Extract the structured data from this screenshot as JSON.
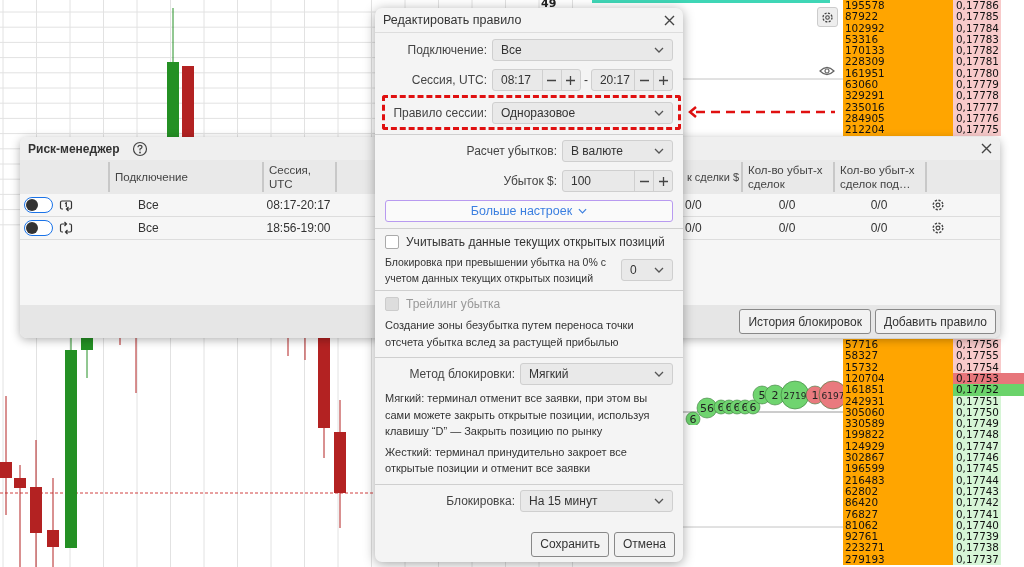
{
  "chart": {
    "axis_label": "49",
    "bubbles": [
      {
        "label": "6",
        "color": "#6fd46f"
      },
      {
        "label": "56",
        "color": "#6fd46f"
      },
      {
        "label": "6",
        "color": "#6fd46f"
      },
      {
        "label": "6",
        "color": "#6fd46f"
      },
      {
        "label": "6",
        "color": "#6fd46f"
      },
      {
        "label": "6",
        "color": "#6fd46f"
      },
      {
        "label": "6",
        "color": "#6fd46f"
      },
      {
        "label": "5",
        "color": "#6fd46f"
      },
      {
        "label": "2",
        "color": "#6fd46f"
      },
      {
        "label": "2719",
        "color": "#6fd46f"
      },
      {
        "label": "1",
        "color": "#e97a7e"
      },
      {
        "label": "6197",
        "color": "#e97a7e"
      }
    ]
  },
  "orderbook": {
    "top_rows": [
      {
        "volume": "195578",
        "price": "0,17786",
        "kind": "ask"
      },
      {
        "volume": "87922",
        "price": "0,17785",
        "kind": "ask"
      },
      {
        "volume": "102992",
        "price": "0,17784",
        "kind": "ask"
      },
      {
        "volume": "53316",
        "price": "0,17783",
        "kind": "ask"
      },
      {
        "volume": "170133",
        "price": "0,17782",
        "kind": "ask"
      },
      {
        "volume": "228309",
        "price": "0,17781",
        "kind": "ask"
      },
      {
        "volume": "161951",
        "price": "0,17780",
        "kind": "ask"
      },
      {
        "volume": "63060",
        "price": "0,17779",
        "kind": "ask"
      },
      {
        "volume": "329291",
        "price": "0,17778",
        "kind": "ask"
      },
      {
        "volume": "235016",
        "price": "0,17777",
        "kind": "ask"
      },
      {
        "volume": "284905",
        "price": "0,17776",
        "kind": "ask"
      },
      {
        "volume": "212204",
        "price": "0,17775",
        "kind": "ask"
      }
    ],
    "bottom_rows": [
      {
        "volume": "57716",
        "price": "0,17756",
        "kind": "ask"
      },
      {
        "volume": "58327",
        "price": "0,17755",
        "kind": "ask"
      },
      {
        "volume": "15732",
        "price": "0,17754",
        "kind": "ask"
      },
      {
        "volume": "120704",
        "price": "0,17753",
        "kind": "best_ask"
      },
      {
        "volume": "161851",
        "price": "0,17752",
        "kind": "best_bid"
      },
      {
        "volume": "242931",
        "price": "0,17751",
        "kind": "bid"
      },
      {
        "volume": "305060",
        "price": "0,17750",
        "kind": "bid"
      },
      {
        "volume": "330589",
        "price": "0,17749",
        "kind": "bid"
      },
      {
        "volume": "199822",
        "price": "0,17748",
        "kind": "bid"
      },
      {
        "volume": "124929",
        "price": "0,17747",
        "kind": "bid"
      },
      {
        "volume": "302867",
        "price": "0,17746",
        "kind": "bid"
      },
      {
        "volume": "196599",
        "price": "0,17745",
        "kind": "bid"
      },
      {
        "volume": "216483",
        "price": "0,17744",
        "kind": "bid"
      },
      {
        "volume": "62802",
        "price": "0,17743",
        "kind": "bid"
      },
      {
        "volume": "86420",
        "price": "0,17742",
        "kind": "bid"
      },
      {
        "volume": "76827",
        "price": "0,17741",
        "kind": "bid"
      },
      {
        "volume": "81062",
        "price": "0,17740",
        "kind": "bid"
      },
      {
        "volume": "92761",
        "price": "0,17739",
        "kind": "bid"
      },
      {
        "volume": "223271",
        "price": "0,17738",
        "kind": "bid"
      },
      {
        "volume": "279193",
        "price": "0,17737",
        "kind": "bid"
      }
    ]
  },
  "risk_manager": {
    "title": "Риск-менеджер",
    "columns": [
      "Подключение",
      "Сессия, UTC",
      "к сделки $",
      "Кол-во убыт-х сделок",
      "Кол-во убыт-х сделок под…"
    ],
    "rules": [
      {
        "on": false,
        "kind": "once",
        "connection": "Все",
        "session": "08:17-20:17",
        "cells": [
          "0/0",
          "0/0",
          "0/0"
        ]
      },
      {
        "on": false,
        "kind": "repeat",
        "connection": "Все",
        "session": "18:56-19:00",
        "cells": [
          "0/0",
          "0/0",
          "0/0"
        ]
      }
    ],
    "buttons": [
      "История блокировок",
      "Добавить правило"
    ]
  },
  "dialog": {
    "title": "Редактировать правило",
    "sections": [
      {
        "rows": [
          {
            "kind": "select",
            "label": "Подключение:",
            "value": "Все",
            "highlighted": false
          },
          {
            "kind": "time_range",
            "label": "Сессия, UTC:",
            "from": "08:17",
            "to": "20:17",
            "separator": "-",
            "highlighted": false
          },
          {
            "kind": "select",
            "label": "Правило сессии:",
            "value": "Одноразовое",
            "highlighted": true
          }
        ]
      },
      {
        "rows": [
          {
            "kind": "select",
            "label": "Расчет убытков:",
            "value": "В валюте",
            "highlighted": false
          },
          {
            "kind": "spinner",
            "label": "Убыток $:",
            "value": "100",
            "highlighted": false
          },
          {
            "kind": "expand_button",
            "label": "Больше настроек",
            "highlighted": false
          }
        ]
      },
      {
        "rows": [
          {
            "kind": "checkbox",
            "label": "Учитывать данные текущих открытых позиций",
            "checked": false,
            "disabled": false
          },
          {
            "kind": "note_select",
            "text": "Блокировка при превышении убытка на 0% с учетом данных текущих открытых позиций",
            "value": "0"
          }
        ]
      },
      {
        "rows": [
          {
            "kind": "checkbox",
            "label": "Трейлинг убытка",
            "checked": false,
            "disabled": true
          },
          {
            "kind": "note",
            "text": "Создание зоны безубытка путем переноса точки отсчета убытка вслед за растущей прибылью"
          }
        ]
      },
      {
        "rows": [
          {
            "kind": "select",
            "label": "Метод блокировки:",
            "value": "Мягкий",
            "highlighted": false
          },
          {
            "kind": "note",
            "text": "Мягкий: терминал отменит все заявки, при этом вы сами можете закрыть открытые позиции, используя клавишу “D” — Закрыть позицию по рынку"
          },
          {
            "kind": "note",
            "text": "Жесткий: терминал принудительно закроет все открытые позиции и отменит все заявки"
          }
        ]
      },
      {
        "rows": [
          {
            "kind": "select",
            "label": "Блокировка:",
            "value": "На 15 минут",
            "highlighted": false
          }
        ]
      }
    ],
    "buttons": [
      "Сохранить",
      "Отмена"
    ]
  }
}
